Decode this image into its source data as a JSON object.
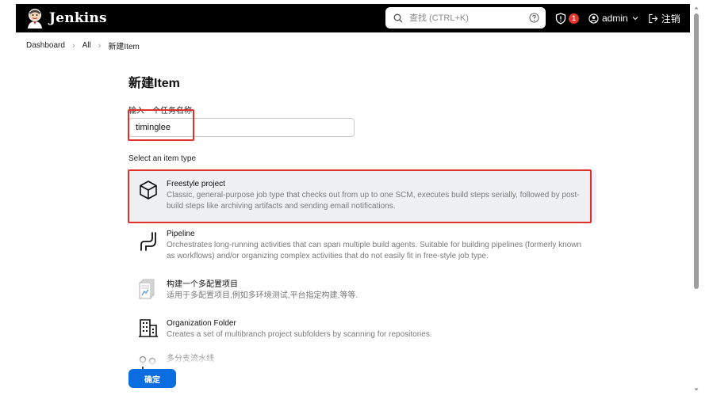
{
  "app": {
    "name": "Jenkins"
  },
  "header": {
    "search_placeholder": "查找 (CTRL+K)",
    "badge_count": "1",
    "user": "admin",
    "logout": "注销"
  },
  "breadcrumb": [
    "Dashboard",
    "All",
    "新建Item"
  ],
  "main": {
    "title": "新建Item",
    "name_label": "输入一个任务名称",
    "name_value": "timinglee",
    "type_label": "Select an item type",
    "types": [
      {
        "name": "Freestyle project",
        "desc": "Classic, general-purpose job type that checks out from up to one SCM, executes build steps serially, followed by post-build steps like archiving artifacts and sending email notifications.",
        "icon": "freestyle-cube-icon"
      },
      {
        "name": "Pipeline",
        "desc": "Orchestrates long-running activities that can span multiple build agents. Suitable for building pipelines (formerly known as workflows) and/or organizing complex activities that do not easily fit in free-style job type.",
        "icon": "pipeline-icon"
      },
      {
        "name": "构建一个多配置项目",
        "desc": "适用于多配置项目,例如多环境测试,平台指定构建,等等.",
        "icon": "multi-config-icon"
      },
      {
        "name": "Organization Folder",
        "desc": "Creates a set of multibranch project subfolders by scanning for repositories.",
        "icon": "organization-folder-icon"
      },
      {
        "name": "多分支流水线",
        "desc": "",
        "icon": "multibranch-icon"
      }
    ],
    "ok_label": "确定"
  },
  "colors": {
    "header_bg": "#000000",
    "accent": "#0b6de0",
    "highlight": "#e0302a",
    "selected_bg": "#eef0f4"
  }
}
